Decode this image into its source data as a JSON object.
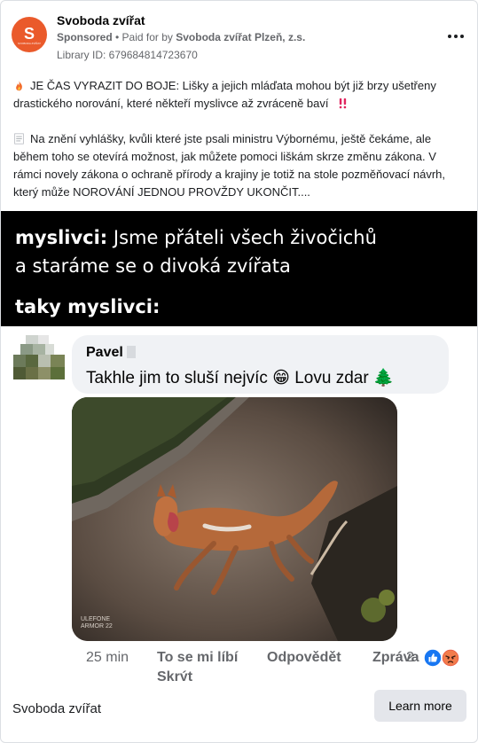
{
  "post": {
    "page_name": "Svoboda zvířat",
    "sponsored_label": "Sponsored",
    "separator": " • ",
    "paid_for_prefix": "Paid for by ",
    "paid_for_by": "Svoboda zvířat Plzeň, z.s.",
    "library_id": "Library ID: 679684814723670",
    "avatar_icon": "svoboda-zvirat-logo",
    "avatar_letter": "S",
    "avatar_caption": "SVOBODA ZVÍŘAT",
    "avatar_color": "#ea5a2b",
    "more_icon": "more-horizontal-icon",
    "paragraph_1_icon": "fire-emoji",
    "paragraph_1": "JE ČAS VYRAZIT DO BOJE: Lišky a jejich mláďata mohou být již brzy ušetřeny drastického norování, které někteří myslivce až zvráceně baví",
    "paragraph_1_end_icon": "double-exclamation-emoji",
    "paragraph_2_icon": "document-emoji",
    "paragraph_2": "Na znění vyhlášky, kvůli které jste psali ministru Výbornému, ještě čekáme, ale během toho se otevírá možnost, jak můžete pomoci liškám skrze změnu zákona. V rámci novely zákona o ochraně přírody a krajiny je totiž na stole pozměňovací návrh, který může NOROVÁNÍ JEDNOU PROVŽDY UKONČIT...."
  },
  "meme": {
    "line1_bold": "myslivci:",
    "line1_rest": " Jsme přáteli všech živočichů",
    "line2": "a staráme se o divoká zvířata",
    "line3": "taky myslivci:",
    "commenter_name": "Pavel",
    "comment_text": "Takhle jim to sluší nejvíc 😁 Lovu zdar 🌲",
    "photo_icon": "dead-fox-photo",
    "watermark_line1": "ULEFONE",
    "watermark_line2": "ARMOR 22",
    "time": "25 min",
    "like_label": "To se mi líbí",
    "reply_label": "Odpovědět",
    "report_label": "Zpráva",
    "hide_label": "Skrýt",
    "reaction_count": "2",
    "reaction_icons": [
      "like-reaction-icon",
      "angry-reaction-icon"
    ]
  },
  "footer": {
    "page_name": "Svoboda zvířat",
    "cta_label": "Learn more"
  },
  "colors": {
    "brand": "#ea5a2b",
    "like_blue": "#1877f2",
    "angry_red": "#e9533f"
  }
}
